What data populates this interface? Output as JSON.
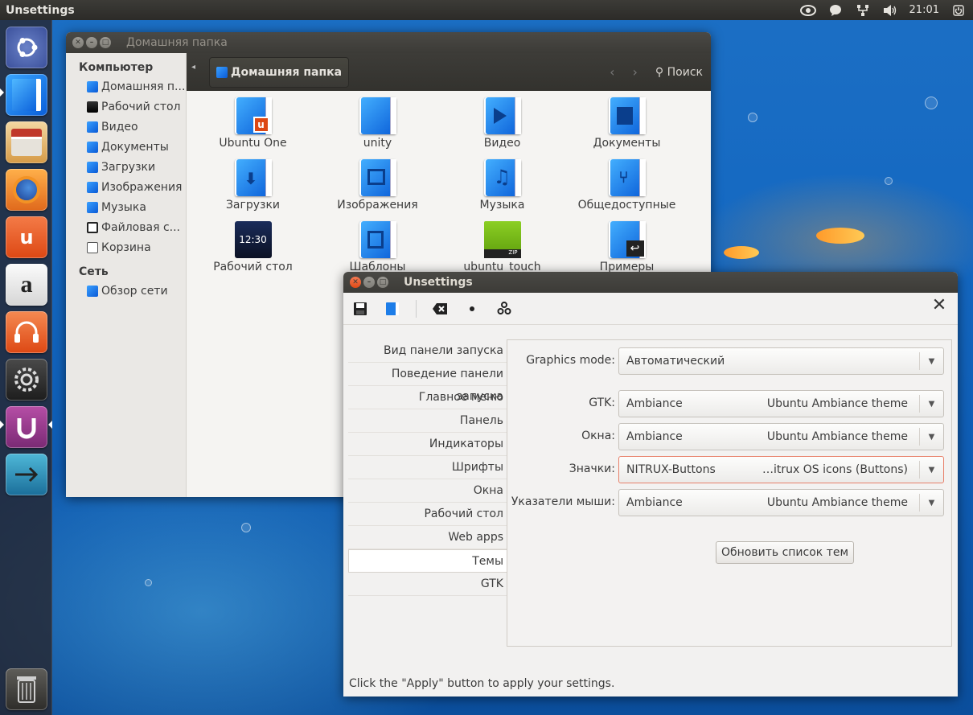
{
  "top_panel": {
    "title": "Unsettings",
    "clock": "21:01",
    "indicators": [
      "eye-icon",
      "messages-icon",
      "network-icon",
      "volume-icon",
      "power-icon"
    ]
  },
  "launcher": {
    "items": [
      "ubuntu-dash",
      "files",
      "software-center",
      "firefox",
      "ubuntu-one",
      "amazon",
      "ubuntu-one-music",
      "system-settings",
      "unsettings",
      "workspace-switcher",
      "trash"
    ]
  },
  "nautilus": {
    "title": "Домашняя папка",
    "sidebar": {
      "computer_header": "Компьютер",
      "computer_items": [
        "Домашняя п...",
        "Рабочий стол",
        "Видео",
        "Документы",
        "Загрузки",
        "Изображения",
        "Музыка",
        "Файловая с...",
        "Корзина"
      ],
      "network_header": "Сеть",
      "network_items": [
        "Обзор сети"
      ]
    },
    "path_button": "Домашняя папка",
    "search_label": "Поиск",
    "files": [
      "Ubuntu One",
      "unity",
      "Видео",
      "Документы",
      "Загрузки",
      "Изображения",
      "Музыка",
      "Общедоступные",
      "Рабочий стол",
      "Шаблоны",
      "ubuntu_touch",
      "Примеры"
    ],
    "desktop_clock": "12:30"
  },
  "unsettings": {
    "title": "Unsettings",
    "sidebar": [
      "Вид панели запуска",
      "Поведение панели запуска",
      "Главное меню",
      "Панель",
      "Индикаторы",
      "Шрифты",
      "Окна",
      "Рабочий стол",
      "Web apps",
      "Темы",
      "GTK"
    ],
    "selected": "Темы",
    "graphics": {
      "label": "Graphics mode:",
      "value": "Автоматический"
    },
    "gtk": {
      "label": "GTK:",
      "value": "Ambiance",
      "desc": "Ubuntu Ambiance theme"
    },
    "windows": {
      "label": "Окна:",
      "value": "Ambiance",
      "desc": "Ubuntu Ambiance theme"
    },
    "icons": {
      "label": "Значки:",
      "value": "NITRUX-Buttons",
      "desc": "…itrux OS icons (Buttons)"
    },
    "cursors": {
      "label": "Указатели мыши:",
      "value": "Ambiance",
      "desc": "Ubuntu Ambiance theme"
    },
    "refresh_button": "Обновить список тем",
    "status": "Click the \"Apply\" button to apply your settings."
  },
  "colors": {
    "accent": "#dd4814",
    "panel": "#3c3b37",
    "selection": "#f07746"
  }
}
